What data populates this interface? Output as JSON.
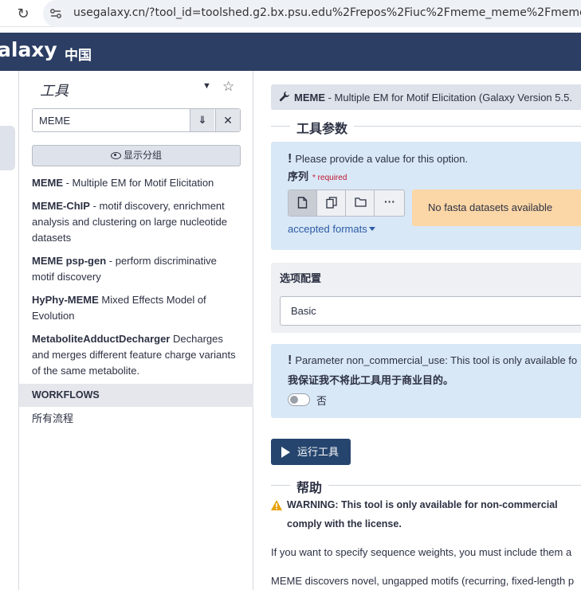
{
  "browser": {
    "url": "usegalaxy.cn/?tool_id=toolshed.g2.bx.psu.edu%2Frepos%2Fiuc%2Fmeme_meme%2Fmeme_me"
  },
  "masthead": {
    "brand": "alaxy",
    "brand_sub": "中国",
    "bg_color": "#2c3e63"
  },
  "tool_panel": {
    "title": "工具",
    "search": {
      "value": "MEME"
    },
    "show_sections_label": "显示分组",
    "tools": [
      {
        "name": "MEME",
        "desc": " - Multiple EM for Motif Elicitation"
      },
      {
        "name": "MEME-ChIP",
        "desc": " - motif discovery, enrichment analysis and clustering on large nucleotide datasets"
      },
      {
        "name": "MEME psp-gen",
        "desc": " - perform discriminative motif discovery"
      },
      {
        "name": "HyPhy-MEME",
        "desc": " Mixed Effects Model of Evolution"
      },
      {
        "name": "MetaboliteAdductDecharger",
        "desc": " Decharges and merges different feature charge variants of the same metabolite."
      }
    ],
    "workflows_header": "WORKFLOWS",
    "all_workflows": "所有流程"
  },
  "tool_form": {
    "header_name": "MEME",
    "header_rest": " - Multiple EM for Motif Elicitation (Galaxy Version 5.5.",
    "params_title": "工具参数",
    "param_msg": "Please provide a value for this option.",
    "param_label": "序列",
    "required_label": "* required",
    "accepted_formats": "accepted formats",
    "no_datasets": "No fasta datasets available",
    "options_title": "选项配置",
    "options_value": "Basic",
    "nc_msg": "Parameter non_commercial_use: This tool is only available fo",
    "nc_label": "我保证我不将此工具用于商业目的。",
    "toggle_label": "否",
    "run_label": "运行工具",
    "help_title": "帮助",
    "warning_line1": "WARNING: This tool is only available for non-commercial",
    "warning_line2": "comply with the license.",
    "help_p1": "If you want to specify sequence weights, you must include them a",
    "help_p2": "MEME discovers novel, ungapped motifs (recurring, fixed-length p"
  },
  "colors": {
    "accent": "#25456e",
    "info_bg": "#d9e8f6",
    "warning_bg": "#fbd6a6",
    "link": "#2c5ba5"
  }
}
